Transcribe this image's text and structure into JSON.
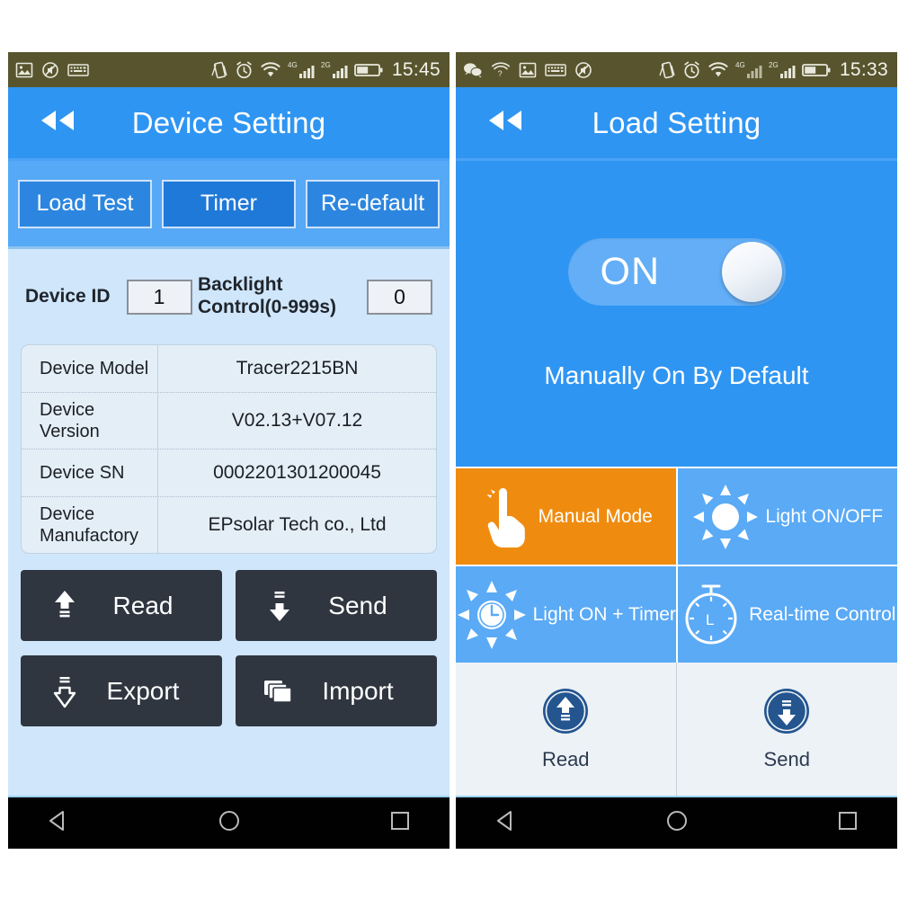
{
  "left_phone": {
    "status_bar": {
      "time": "15:45",
      "left_icons": [
        "image-icon",
        "mute-icon",
        "keyboard-icon"
      ],
      "right_icons": [
        "vibrate-icon",
        "alarm-icon",
        "wifi-icon",
        "signal-4g-icon",
        "signal-2g-icon",
        "battery-icon"
      ],
      "network_labels": [
        "4G",
        "2G"
      ]
    },
    "header": {
      "title": "Device Setting",
      "back_icon": "back-double-arrow-icon"
    },
    "tabs": [
      {
        "label": "Load Test",
        "active": false
      },
      {
        "label": "Timer",
        "active": true
      },
      {
        "label": "Re-default",
        "active": false
      }
    ],
    "fields": [
      {
        "label": "Device ID",
        "value": "1"
      },
      {
        "label": "Backlight Control(0-999s)",
        "value": "0"
      }
    ],
    "info_table": {
      "rows": [
        {
          "key": "Device Model",
          "value": "Tracer2215BN"
        },
        {
          "key": "Device Version",
          "value": "V02.13+V07.12"
        },
        {
          "key": "Device SN",
          "value": "0002201301200045"
        },
        {
          "key": "Device Manufactory",
          "value": "EPsolar Tech co., Ltd"
        }
      ]
    },
    "buttons": [
      {
        "label": "Read",
        "icon": "arrow-up-read-icon"
      },
      {
        "label": "Send",
        "icon": "arrow-down-send-icon"
      },
      {
        "label": "Export",
        "icon": "arrow-down-export-icon"
      },
      {
        "label": "Import",
        "icon": "stacked-pages-import-icon"
      }
    ]
  },
  "right_phone": {
    "status_bar": {
      "time": "15:33",
      "left_icons": [
        "wechat-icon",
        "wifi-question-icon",
        "image-icon",
        "keyboard-icon",
        "mute-icon"
      ],
      "right_icons": [
        "vibrate-icon",
        "alarm-icon",
        "wifi-icon",
        "signal-4g-icon",
        "signal-2g-icon",
        "battery-icon"
      ],
      "network_labels": [
        "4G",
        "2G"
      ]
    },
    "header": {
      "title": "Load Setting",
      "back_icon": "back-double-arrow-icon"
    },
    "toggle": {
      "state_label": "ON",
      "caption": "Manually On By Default",
      "checked": true
    },
    "modes": [
      {
        "label": "Manual Mode",
        "icon": "pointing-hand-icon",
        "active": true
      },
      {
        "label": "Light ON/OFF",
        "icon": "sun-icon",
        "active": false
      },
      {
        "label": "Light ON + Timer",
        "icon": "sun-clock-icon",
        "active": false
      },
      {
        "label": "Real-time Control",
        "icon": "stopwatch-icon",
        "active": false
      }
    ],
    "footer_actions": [
      {
        "label": "Read",
        "icon": "circle-arrow-up-icon"
      },
      {
        "label": "Send",
        "icon": "circle-arrow-down-icon"
      }
    ]
  },
  "nav_bar": {
    "buttons": [
      {
        "name": "back",
        "icon": "triangle-back-icon"
      },
      {
        "name": "home",
        "icon": "circle-home-icon"
      },
      {
        "name": "recents",
        "icon": "square-recents-icon"
      }
    ]
  },
  "colors": {
    "accent_blue": "#2f95f2",
    "light_blue": "#5aaaf6",
    "panel_bg": "#cfe6fb",
    "active_orange": "#ef8c10",
    "dark_button": "#2f3640",
    "status_bar": "#58552e"
  }
}
